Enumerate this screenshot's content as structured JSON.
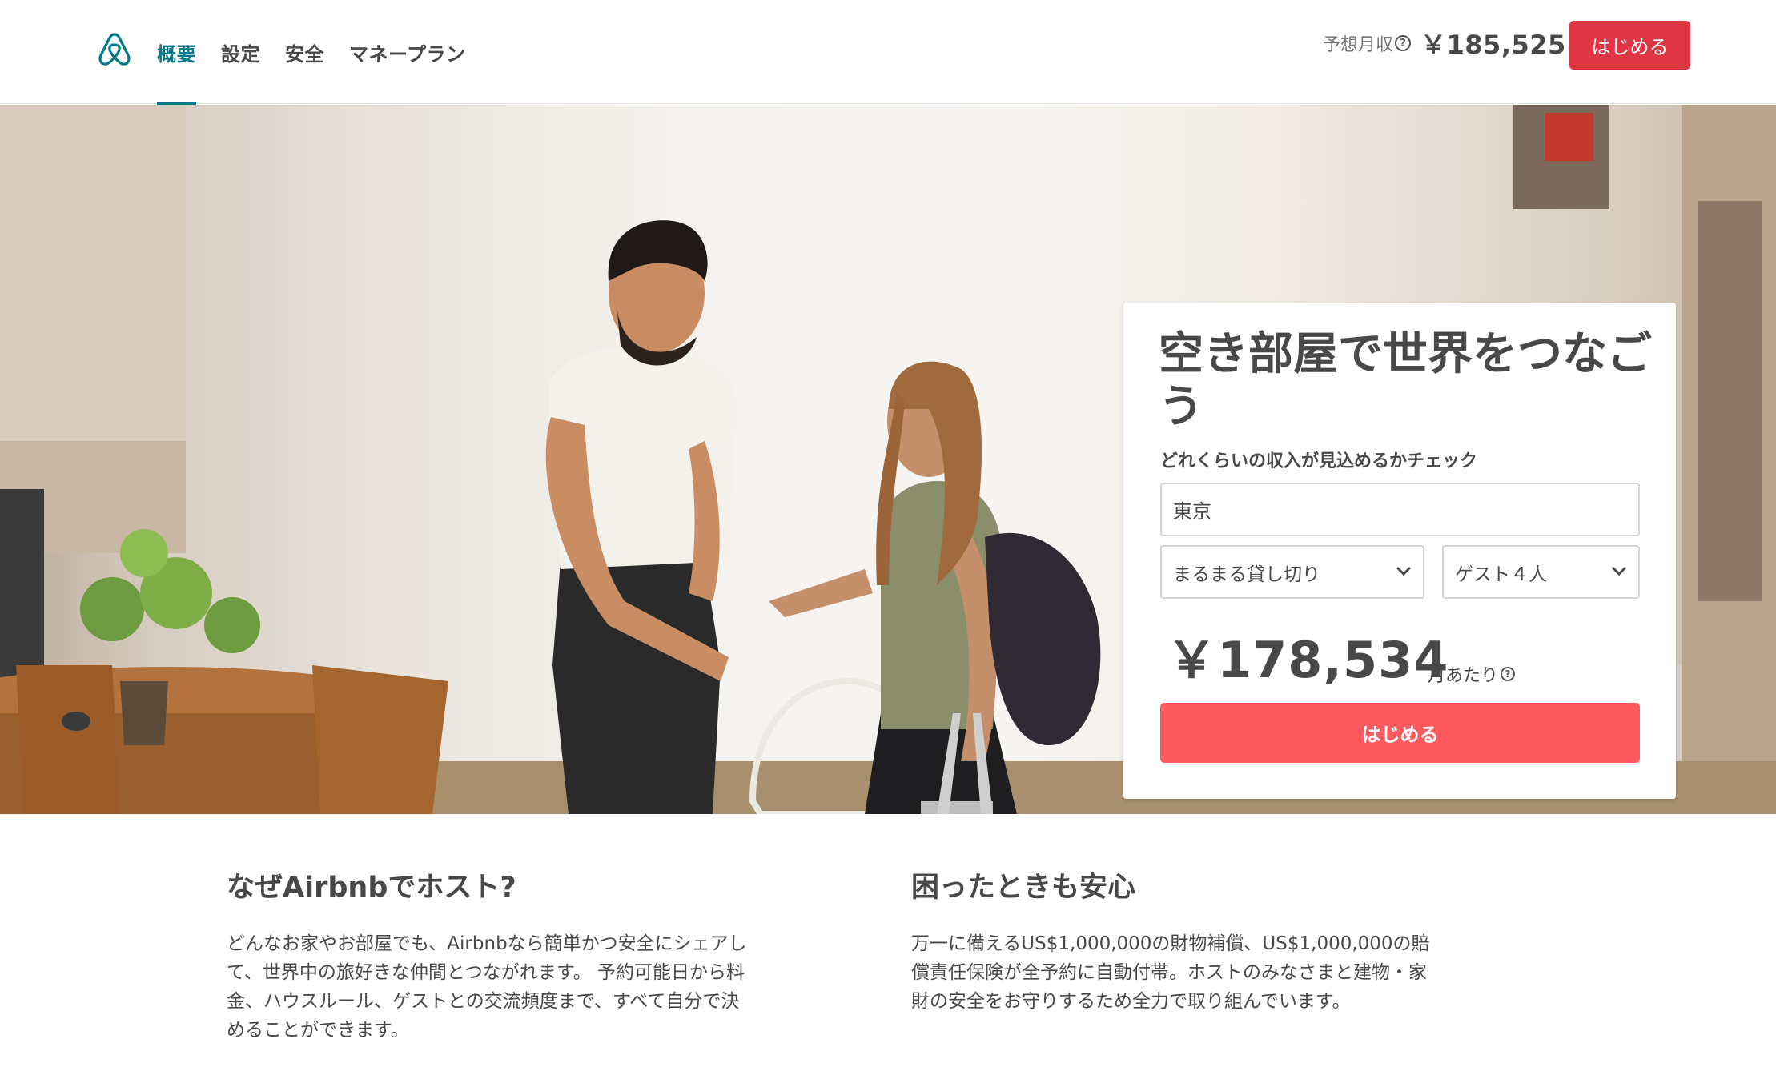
{
  "nav": {
    "logo_icon": "airbnb-belo-icon",
    "items": [
      {
        "label": "概要",
        "active": true
      },
      {
        "label": "設定",
        "active": false
      },
      {
        "label": "安全",
        "active": false
      },
      {
        "label": "マネープラン",
        "active": false
      }
    ],
    "estimate_label": "予想月収",
    "estimate_help_icon": "question-circle-icon",
    "estimate_value": "￥185,525",
    "start_button": "はじめる"
  },
  "colors": {
    "brand_teal": "#007a87",
    "header_button": "#e03643",
    "card_button": "#ff5a5f",
    "text": "#484848"
  },
  "hero": {
    "image": "host-greeting-guest-photo",
    "card": {
      "title": "空き部屋で世界をつなごう",
      "subtitle": "どれくらいの収入が見込めるかチェック",
      "city_value": "東京",
      "room_type": "まるまる貸し切り",
      "guests": "ゲスト４人",
      "price": "￥178,534",
      "per_month": "月あたり",
      "start_button": "はじめる"
    }
  },
  "sections": [
    {
      "title": "なぜAirbnbでホスト?",
      "body": "どんなお家やお部屋でも、Airbnbなら簡単かつ安全にシェアして、世界中の旅好きな仲間とつながれます。 予約可能日から料金、ハウスルール、ゲストとの交流頻度まで、すべて自分で決めることができます。"
    },
    {
      "title": "困ったときも安心",
      "body": "万一に備えるUS$1,000,000の財物補償、US$1,000,000の賠償責任保険が全予約に自動付帯。ホストのみなさまと建物・家財の安全をお守りするため全力で取り組んでいます。"
    }
  ]
}
